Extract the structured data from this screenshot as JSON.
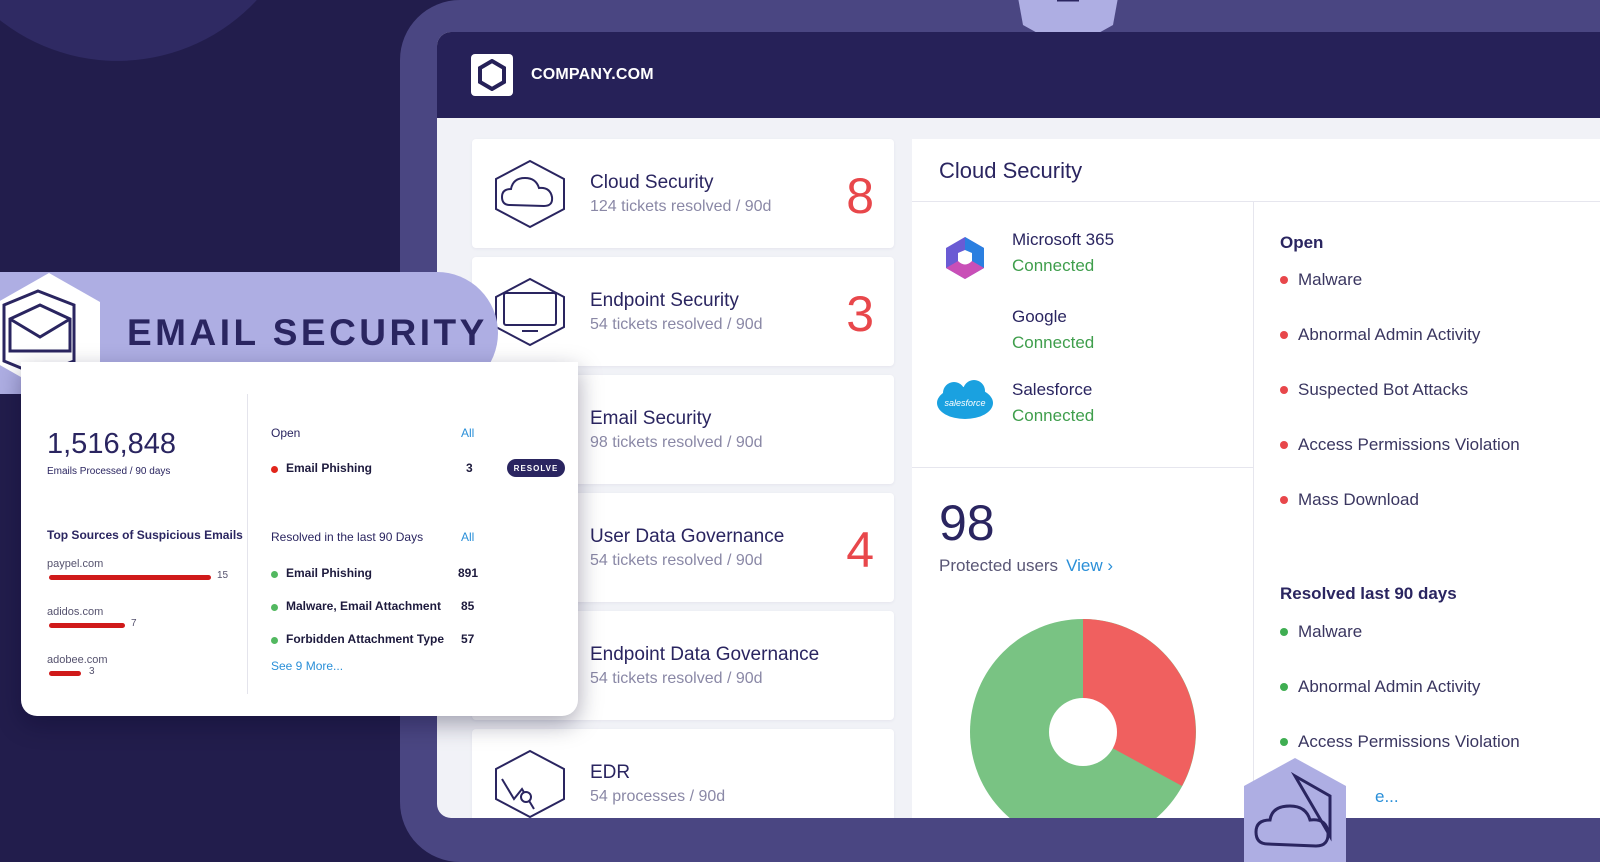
{
  "brand": {
    "name": "COMPANY.COM"
  },
  "colors": {
    "navy": "#262158",
    "accent_red": "#e8474b",
    "green": "#3f9e4c",
    "lavender": "#aeaee3",
    "link": "#2a8fd8"
  },
  "cards": [
    {
      "title": "Cloud Security",
      "subtitle": "124 tickets resolved / 90d",
      "count": "8",
      "icon": "cloud-icon"
    },
    {
      "title": "Endpoint Security",
      "subtitle": "54 tickets resolved / 90d",
      "count": "3",
      "icon": "monitor-icon"
    },
    {
      "title": "Email Security",
      "subtitle": "98 tickets resolved / 90d",
      "count": "",
      "icon": "mail-icon"
    },
    {
      "title": "User Data Governance",
      "subtitle": "54 tickets resolved / 90d",
      "count": "4",
      "icon": "user-data-icon"
    },
    {
      "title": "Endpoint Data Governance",
      "subtitle": "54 tickets resolved / 90d",
      "count": "",
      "icon": "endpoint-data-icon"
    },
    {
      "title": "EDR",
      "subtitle": "54 processes / 90d",
      "count": "",
      "icon": "edr-icon"
    }
  ],
  "detail": {
    "title": "Cloud Security",
    "integrations": [
      {
        "name": "Microsoft 365",
        "status": "Connected"
      },
      {
        "name": "Google",
        "status": "Connected"
      },
      {
        "name": "Salesforce",
        "status": "Connected",
        "logo_text": "salesforce"
      }
    ],
    "protected_count": "98",
    "protected_label": "Protected users",
    "view_link": "View ›",
    "open_heading": "Open",
    "open_items": [
      "Malware",
      "Abnormal Admin Activity",
      "Suspected Bot Attacks",
      "Access Permissions Violation",
      "Mass Download"
    ],
    "resolved_heading": "Resolved last 90 days",
    "resolved_items": [
      "Malware",
      "Abnormal Admin Activity",
      "Access Permissions Violation"
    ],
    "resolved_more": "e..."
  },
  "email_panel": {
    "banner_title": "EMAIL SECURITY",
    "metric_value": "1,516,848",
    "metric_label": "Emails Processed / 90 days",
    "sources_title": "Top Sources of Suspicious Emails",
    "sources": [
      {
        "domain": "paypel.com",
        "count": "15",
        "value": 15
      },
      {
        "domain": "adidos.com",
        "count": "7",
        "value": 7
      },
      {
        "domain": "adobee.com",
        "count": "3",
        "value": 3
      }
    ],
    "open_heading": "Open",
    "all_label": "All",
    "open_items": [
      {
        "label": "Email Phishing",
        "count": "3"
      }
    ],
    "resolve_label": "RESOLVE",
    "resolved_heading": "Resolved in the last 90 Days",
    "resolved_items": [
      {
        "label": "Email Phishing",
        "count": "891"
      },
      {
        "label": "Malware, Email Attachment",
        "count": "85"
      },
      {
        "label": "Forbidden Attachment Type",
        "count": "57"
      }
    ],
    "see_more": "See 9 More..."
  }
}
